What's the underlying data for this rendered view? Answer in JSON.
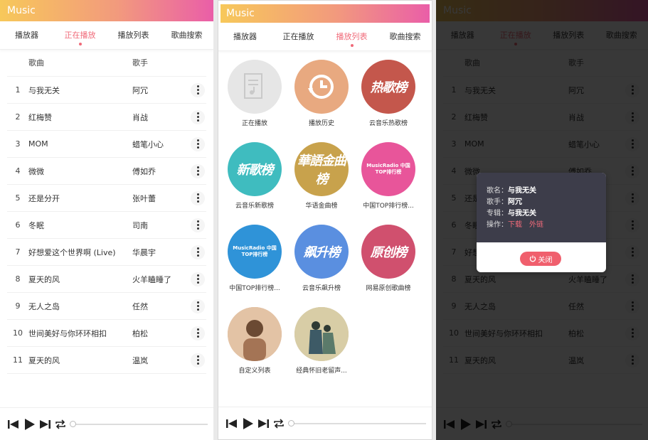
{
  "app": {
    "title": "Music"
  },
  "tabs": [
    "播放器",
    "正在播放",
    "播放列表",
    "歌曲搜索"
  ],
  "list": {
    "header": {
      "song": "歌曲",
      "artist": "歌手"
    },
    "rows": [
      {
        "idx": "1",
        "song": "与我无关",
        "artist": "阿冗"
      },
      {
        "idx": "2",
        "song": "红梅赞",
        "artist": "肖战"
      },
      {
        "idx": "3",
        "song": "MOM",
        "artist": "蜡笔小心"
      },
      {
        "idx": "4",
        "song": "微微",
        "artist": "傅如乔"
      },
      {
        "idx": "5",
        "song": "还是分开",
        "artist": "张叶蕾"
      },
      {
        "idx": "6",
        "song": "冬眠",
        "artist": "司南"
      },
      {
        "idx": "7",
        "song": "好想爱这个世界啊 (Live)",
        "artist": "华晨宇"
      },
      {
        "idx": "8",
        "song": "夏天的风",
        "artist": "火羊瞌睡了"
      },
      {
        "idx": "9",
        "song": "无人之岛",
        "artist": "任然"
      },
      {
        "idx": "10",
        "song": "世间美好与你环环相扣",
        "artist": "柏松"
      },
      {
        "idx": "11",
        "song": "夏天的风",
        "artist": "温岚"
      }
    ]
  },
  "playlists": [
    {
      "label": "正在播放",
      "art": "doc-icon",
      "color": "#e6e6e6"
    },
    {
      "label": "播放历史",
      "art": "history-icon",
      "color": "#e8a980"
    },
    {
      "label": "云音乐热歌榜",
      "art": "热歌榜",
      "color": "#c4574c"
    },
    {
      "label": "云音乐新歌榜",
      "art": "新歌榜",
      "color": "#3fbcbf"
    },
    {
      "label": "华语金曲榜",
      "art": "華語金曲榜",
      "color": "#c8a24c"
    },
    {
      "label": "中国TOP排行榜...",
      "art": "MusicRadio 中国TOP排行榜",
      "color": "#e8559a"
    },
    {
      "label": "中国TOP排行榜...",
      "art": "MusicRadio 中国TOP排行榜",
      "color": "#2f93d8"
    },
    {
      "label": "云音乐飙升榜",
      "art": "飙升榜",
      "color": "#5a8fe0"
    },
    {
      "label": "网易原创歌曲榜",
      "art": "原创榜",
      "color": "#d0506e"
    },
    {
      "label": "自定义列表",
      "art": "person-photo",
      "color": "#d9a984"
    },
    {
      "label": "经典怀旧老留声...",
      "art": "couple-painting",
      "color": "#cdbf9a"
    }
  ],
  "dialog": {
    "name_label": "歌名：",
    "name_value": "与我无关",
    "artist_label": "歌手：",
    "artist_value": "阿冗",
    "album_label": "专辑：",
    "album_value": "与我无关",
    "action_label": "操作：",
    "download": "下载",
    "outlink": "外链",
    "close": "关闭"
  },
  "colors": {
    "accent": "#f06a79",
    "gradient_start": "#f7c85a",
    "gradient_end": "#ea5ea8"
  }
}
